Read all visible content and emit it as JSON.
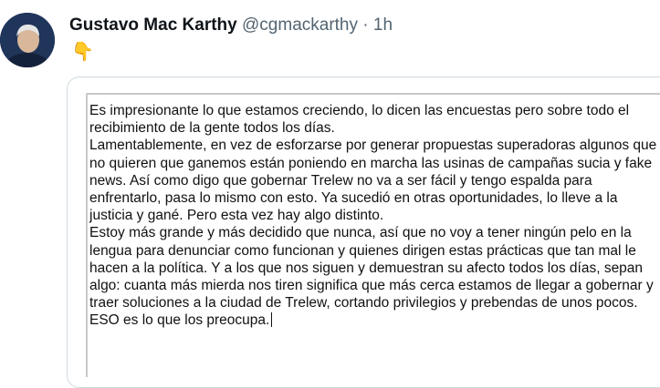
{
  "tweet": {
    "author_name": "Gustavo Mac Karthy",
    "handle": "@cgmackarthy",
    "separator": "·",
    "time": "1h",
    "emoji": "👇"
  },
  "note": {
    "paragraphs": [
      "Es impresionante lo que estamos creciendo, lo dicen las encuestas pero sobre todo el recibimiento de la gente todos los días.",
      "Lamentablemente, en vez de esforzarse por generar propuestas superadoras algunos que no quieren que ganemos están poniendo en marcha las usinas de campañas sucia y fake news. Así como digo que gobernar Trelew no va a ser fácil y tengo espalda para enfrentarlo, pasa lo mismo con esto. Ya sucedió en otras oportunidades, lo lleve a la justicia y gané. Pero esta vez hay algo distinto.",
      "Estoy más grande y más decidido que nunca, así que no voy a tener ningún pelo en la lengua para denunciar como funcionan y quienes dirigen estas prácticas que tan mal le hacen a la política. Y a los que nos siguen y demuestran su afecto todos los días, sepan algo: cuanta más mierda nos tiren significa que más cerca estamos de llegar a gobernar y traer soluciones a la ciudad de Trelew, cortando privilegios y prebendas de unos pocos. ESO es lo que los preocupa."
    ]
  }
}
